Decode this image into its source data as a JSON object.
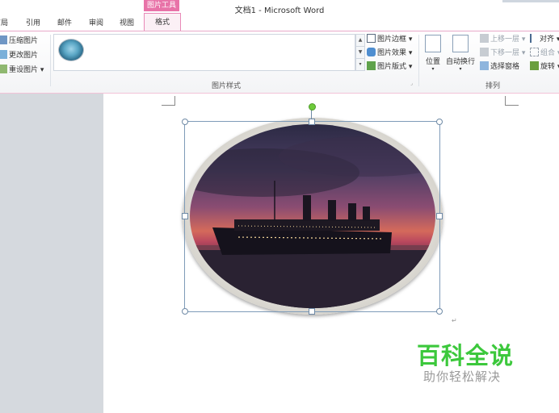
{
  "window": {
    "title": "文档1 - Microsoft Word",
    "context_tab": "图片工具"
  },
  "tabs": [
    {
      "label": "布局"
    },
    {
      "label": "引用"
    },
    {
      "label": "邮件"
    },
    {
      "label": "审阅"
    },
    {
      "label": "视图"
    },
    {
      "label": "格式"
    }
  ],
  "ribbon": {
    "adjust": {
      "compress": "压缩图片",
      "change": "更改图片",
      "reset": "重设图片"
    },
    "picture_styles": {
      "group_label": "图片样式",
      "border": "图片边框",
      "effects": "图片效果",
      "layout": "图片版式"
    },
    "arrange": {
      "group_label": "排列",
      "position": "位置",
      "wrap": "自动换行",
      "bring_forward": "上移一层",
      "send_backward": "下移一层",
      "selection_pane": "选择窗格",
      "align": "对齐",
      "group": "组合",
      "rotate": "旋转"
    }
  },
  "watermark": {
    "main": "百科全说",
    "sub": "助你轻松解决"
  },
  "colors": {
    "accent_pink": "#e873a8",
    "watermark_green": "#3cc83c"
  }
}
